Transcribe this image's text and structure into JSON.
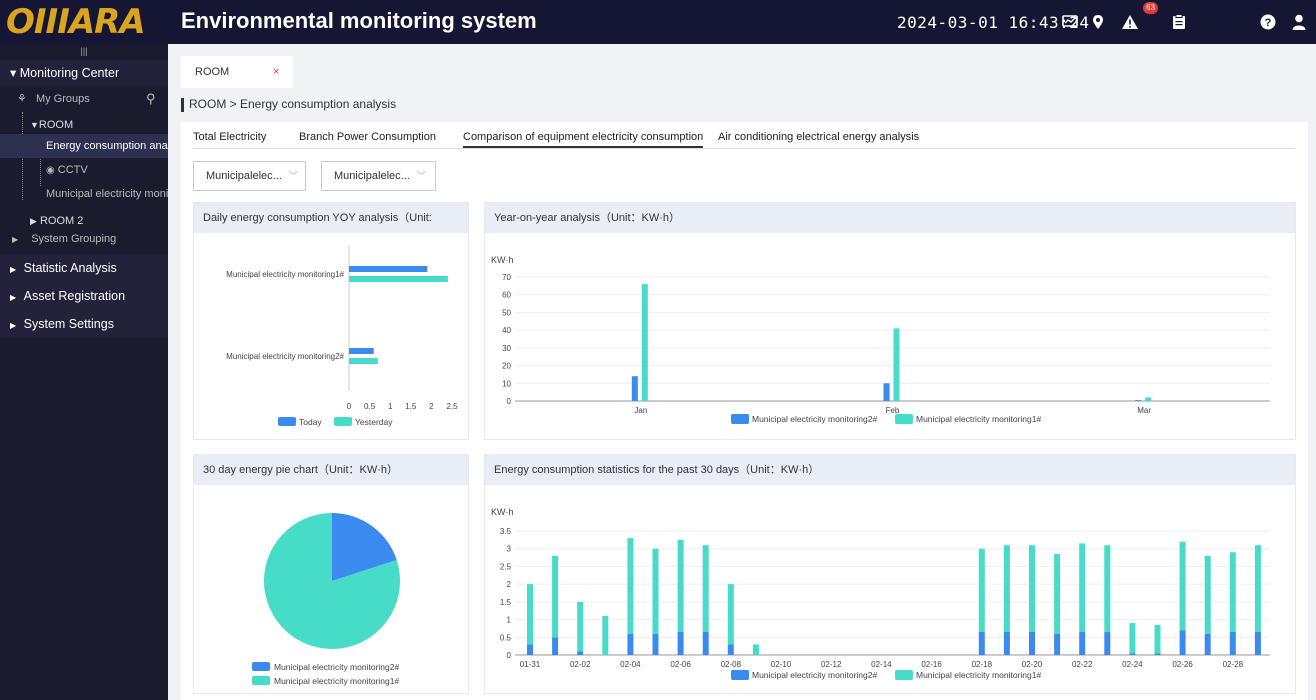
{
  "header": {
    "logo": "OIIIARA",
    "title": "Environmental monitoring system",
    "datetime": "2024-03-01 16:43:24",
    "alert_count": "63"
  },
  "sidebar": {
    "monitoring_center": "▾ Monitoring Center",
    "my_groups": "My Groups",
    "room": "ROOM",
    "energy": "Energy consumption analy",
    "cctv": "CCTV",
    "municipal": "Municipal electricity monit",
    "room2": "ROOM 2",
    "system_grouping": "System Grouping",
    "statistic": "Statistic Analysis",
    "asset": "Asset Registration",
    "settings": "System Settings"
  },
  "tabs": {
    "room": "ROOM",
    "close": "×"
  },
  "breadcrumb": "ROOM  >  Energy consumption analysis",
  "subtabs": [
    "Total Electricity",
    "Branch Power Consumption",
    "Comparison of equipment electricity consumption",
    "Air conditioning electrical energy analysis"
  ],
  "selects": [
    "Municipalelec...",
    "Municipalelec..."
  ],
  "cards": {
    "daily": "Daily energy consumption YOY analysis（Unit:",
    "yoy": "Year-on-year analysis（Unit：KW·h）",
    "pie": "30 day energy pie chart（Unit：KW·h）",
    "stats": "Energy consumption statistics for the past 30 days（Unit：KW·h）"
  },
  "chart_data": [
    {
      "type": "bar",
      "orientation": "horizontal",
      "categories": [
        "Municipal electricity monitoring1#",
        "Municipal electricity monitoring2#"
      ],
      "series": [
        {
          "name": "Today",
          "color": "#3b8af0",
          "values": [
            1.9,
            0.6
          ]
        },
        {
          "name": "Yesterday",
          "color": "#47dcc8",
          "values": [
            2.4,
            0.7
          ]
        }
      ],
      "xticks": [
        "0",
        "0.5",
        "1",
        "1.5",
        "2",
        "2.5"
      ],
      "xlim": [
        0,
        2.5
      ]
    },
    {
      "type": "bar",
      "ylabel": "KW·h",
      "categories": [
        "Jan",
        "Feb",
        "Mar"
      ],
      "yticks": [
        "0",
        "10",
        "20",
        "30",
        "40",
        "50",
        "60",
        "70"
      ],
      "ylim": [
        0,
        70
      ],
      "series": [
        {
          "name": "Municipal electricity monitoring2#",
          "color": "#3b8af0",
          "values": [
            14,
            10,
            0.5
          ]
        },
        {
          "name": "Municipal electricity monitoring1#",
          "color": "#47dcc8",
          "values": [
            66,
            41,
            2
          ]
        }
      ]
    },
    {
      "type": "pie",
      "series": [
        {
          "name": "Municipal electricity monitoring2#",
          "color": "#3b8af0",
          "value": 20
        },
        {
          "name": "Municipal electricity monitoring1#",
          "color": "#47dcc8",
          "value": 80
        }
      ]
    },
    {
      "type": "bar",
      "stacked": true,
      "ylabel": "KW·h",
      "ylim": [
        0,
        3.5
      ],
      "yticks": [
        "0",
        "0.5",
        "1",
        "1.5",
        "2",
        "2.5",
        "3",
        "3.5"
      ],
      "categories": [
        "01-31",
        "02-01",
        "02-02",
        "02-03",
        "02-04",
        "02-05",
        "02-06",
        "02-07",
        "02-08",
        "02-09",
        "02-10",
        "02-11",
        "02-12",
        "02-13",
        "02-14",
        "02-15",
        "02-16",
        "02-17",
        "02-18",
        "02-19",
        "02-20",
        "02-21",
        "02-22",
        "02-23",
        "02-24",
        "02-25",
        "02-26",
        "02-27",
        "02-28",
        "02-29"
      ],
      "xticks": [
        "01-31",
        "02-02",
        "02-04",
        "02-06",
        "02-08",
        "02-10",
        "02-12",
        "02-14",
        "02-16",
        "02-18",
        "02-20",
        "02-22",
        "02-24",
        "02-26",
        "02-28"
      ],
      "series": [
        {
          "name": "Municipal electricity monitoring2#",
          "color": "#3b8af0",
          "values": [
            0.3,
            0.5,
            0.1,
            0,
            0.6,
            0.6,
            0.65,
            0.65,
            0.3,
            0,
            0,
            0,
            0,
            0,
            0,
            0,
            0,
            0,
            0.65,
            0.65,
            0.65,
            0.6,
            0.65,
            0.65,
            0.05,
            0.05,
            0.7,
            0.6,
            0.65,
            0.65
          ]
        },
        {
          "name": "Municipal electricity monitoring1#",
          "color": "#47dcc8",
          "values": [
            1.7,
            2.3,
            1.4,
            1.1,
            2.7,
            2.4,
            2.6,
            2.45,
            1.7,
            0.3,
            0,
            0,
            0,
            0,
            0,
            0,
            0,
            0,
            2.35,
            2.45,
            2.45,
            2.25,
            2.5,
            2.45,
            0.85,
            0.8,
            2.5,
            2.2,
            2.25,
            2.45
          ]
        }
      ]
    }
  ]
}
